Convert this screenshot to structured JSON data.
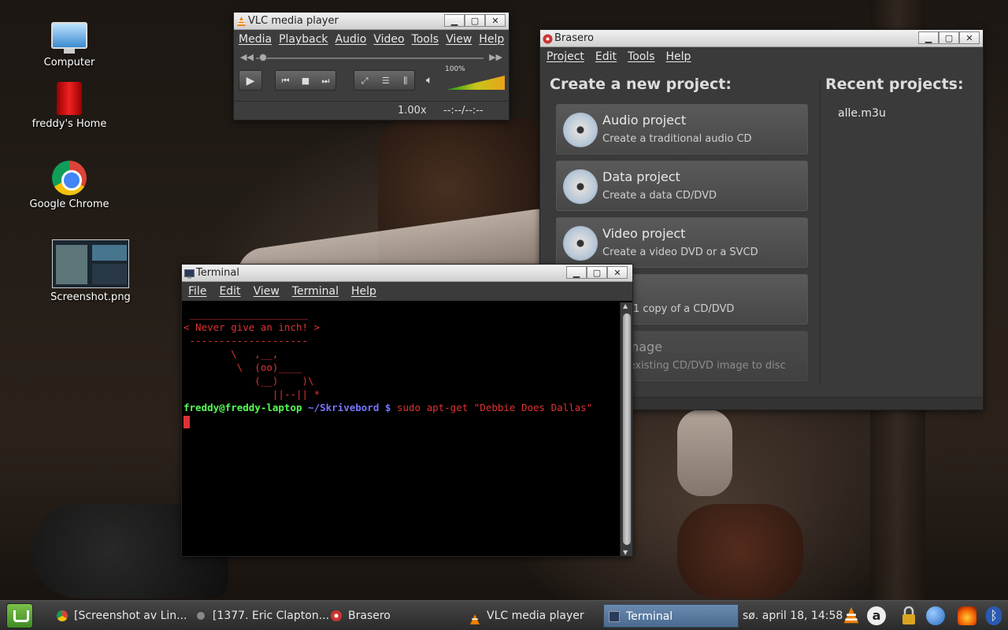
{
  "desktop": {
    "icons": [
      {
        "label": "Computer"
      },
      {
        "label": "freddy's Home"
      },
      {
        "label": "Google Chrome"
      },
      {
        "label": "Screenshot.png"
      }
    ]
  },
  "vlc": {
    "title": "VLC media player",
    "menus": [
      "Media",
      "Playback",
      "Audio",
      "Video",
      "Tools",
      "View",
      "Help"
    ],
    "volume_label": "100%",
    "volume_level": 1.0,
    "speed": "1.00x",
    "time": "--:--/--:--",
    "icons": {
      "play": "play-icon",
      "prev": "previous-icon",
      "stop": "stop-icon",
      "next": "next-icon",
      "fullscreen": "fullscreen-icon",
      "playlist": "playlist-icon",
      "equalizer": "equalizer-icon",
      "speaker": "speaker-icon"
    }
  },
  "brasero": {
    "title": "Brasero",
    "menus": [
      "Project",
      "Edit",
      "Tools",
      "Help"
    ],
    "create_heading": "Create a new project:",
    "recent_heading": "Recent projects:",
    "projects": [
      {
        "title": "Audio project",
        "desc": "Create a traditional audio CD"
      },
      {
        "title": "Data project",
        "desc": "Create a data CD/DVD"
      },
      {
        "title": "Video project",
        "desc": "Create a video DVD or a SVCD"
      },
      {
        "title": "copy",
        "desc": "Cre     1:1 copy of a CD/DVD"
      },
      {
        "title": "Bu     image",
        "desc": "Bu     n existing CD/DVD image to disc"
      }
    ],
    "recent": [
      "alle.m3u"
    ]
  },
  "terminal": {
    "title": "Terminal",
    "menus": [
      "File",
      "Edit",
      "View",
      "Terminal",
      "Help"
    ],
    "lines": [
      " ____________________",
      "< Never give an inch! >",
      " --------------------",
      "        \\   ,__,",
      "         \\  (oo)____",
      "            (__)    )\\",
      "               ||--|| *"
    ],
    "prompt_user": "freddy@freddy-laptop",
    "prompt_path": "~/Skrivebord $",
    "command": "sudo apt-get \"Debbie Does Dallas\""
  },
  "panel": {
    "tasks": [
      {
        "label": "[Screenshot av Lin..."
      },
      {
        "label": "[1377. Eric Clapton..."
      },
      {
        "label": "Brasero"
      },
      {
        "label": "VLC media player"
      },
      {
        "label": "Terminal"
      }
    ],
    "clock": "sø. april 18, 14:58",
    "colors": {
      "accent": "#4a6a90",
      "menu": "#3e8b23"
    }
  }
}
